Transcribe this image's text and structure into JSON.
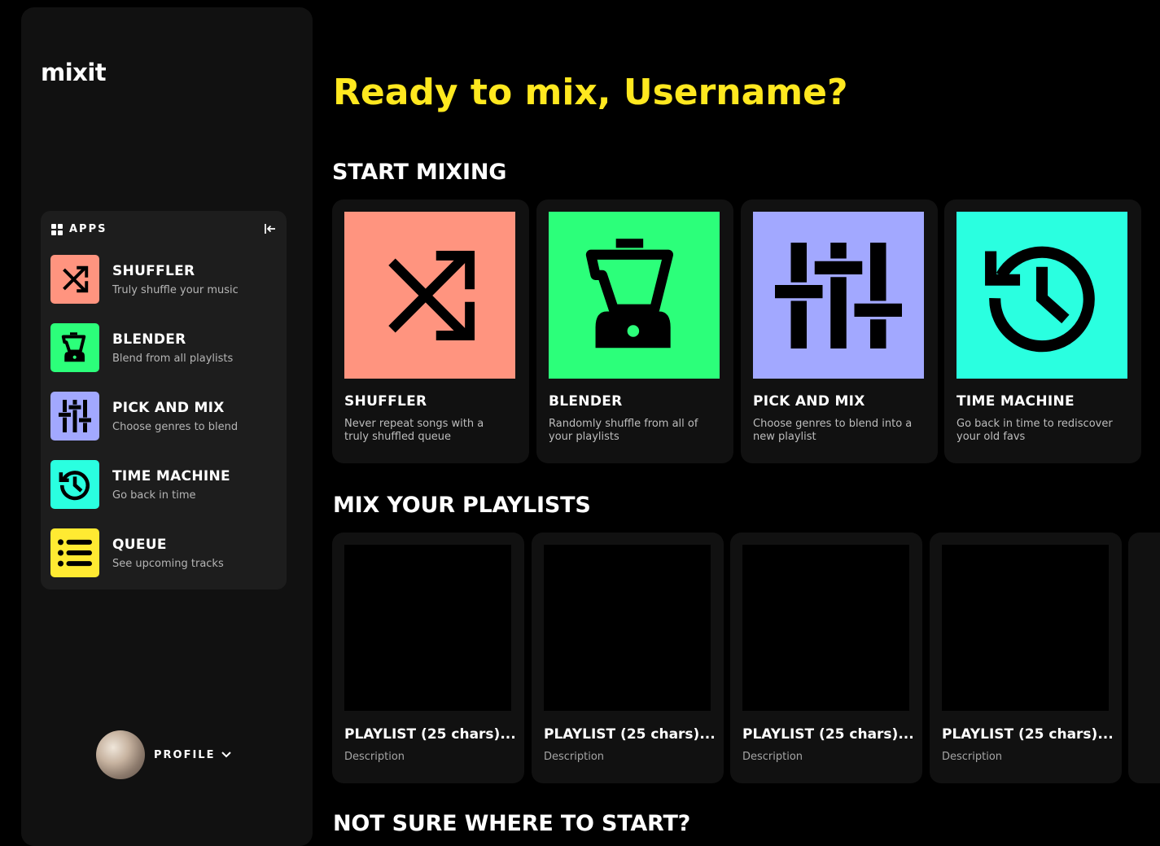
{
  "sidebar": {
    "logo": "mixit",
    "apps": {
      "label": "APPS",
      "items": [
        {
          "title": "SHUFFLER",
          "subtitle": "Truly shuffle your music",
          "icon": "shuffle-icon",
          "color": "#ff947f"
        },
        {
          "title": "BLENDER",
          "subtitle": "Blend from all playlists",
          "icon": "blender-icon",
          "color": "#2cff7a"
        },
        {
          "title": "PICK AND MIX",
          "subtitle": "Choose genres to blend",
          "icon": "sliders-icon",
          "color": "#a2a8ff"
        },
        {
          "title": "TIME MACHINE",
          "subtitle": "Go back in time",
          "icon": "history-icon",
          "color": "#2affe0"
        },
        {
          "title": "QUEUE",
          "subtitle": "See upcoming tracks",
          "icon": "list-icon",
          "color": "#ffea32"
        }
      ]
    },
    "profile": {
      "label": "PROFILE"
    }
  },
  "main": {
    "greeting": "Ready to mix, Username?",
    "start_mixing": {
      "title": "START MIXING",
      "cards": [
        {
          "title": "SHUFFLER",
          "description": "Never repeat songs with a truly shuffled queue"
        },
        {
          "title": "BLENDER",
          "description": "Randomly shuffle from all of your playlists"
        },
        {
          "title": "PICK AND MIX",
          "description": "Choose genres to blend into a new playlist"
        },
        {
          "title": "TIME MACHINE",
          "description": "Go back in time to rediscover your old favs"
        }
      ]
    },
    "playlists": {
      "title": "MIX YOUR PLAYLISTS",
      "items": [
        {
          "title": "PLAYLIST (25 chars)...",
          "description": "Description"
        },
        {
          "title": "PLAYLIST (25 chars)...",
          "description": "Description"
        },
        {
          "title": "PLAYLIST (25 chars)...",
          "description": "Description"
        },
        {
          "title": "PLAYLIST (25 chars)...",
          "description": "Description"
        }
      ]
    },
    "next_section_title": "NOT SURE WHERE TO START?"
  },
  "colors": {
    "accent": "#ffe81f",
    "shuffler": "#ff947f",
    "blender": "#2cff7a",
    "pick_and_mix": "#a2a8ff",
    "time_machine": "#2affe0",
    "queue": "#ffea32"
  }
}
